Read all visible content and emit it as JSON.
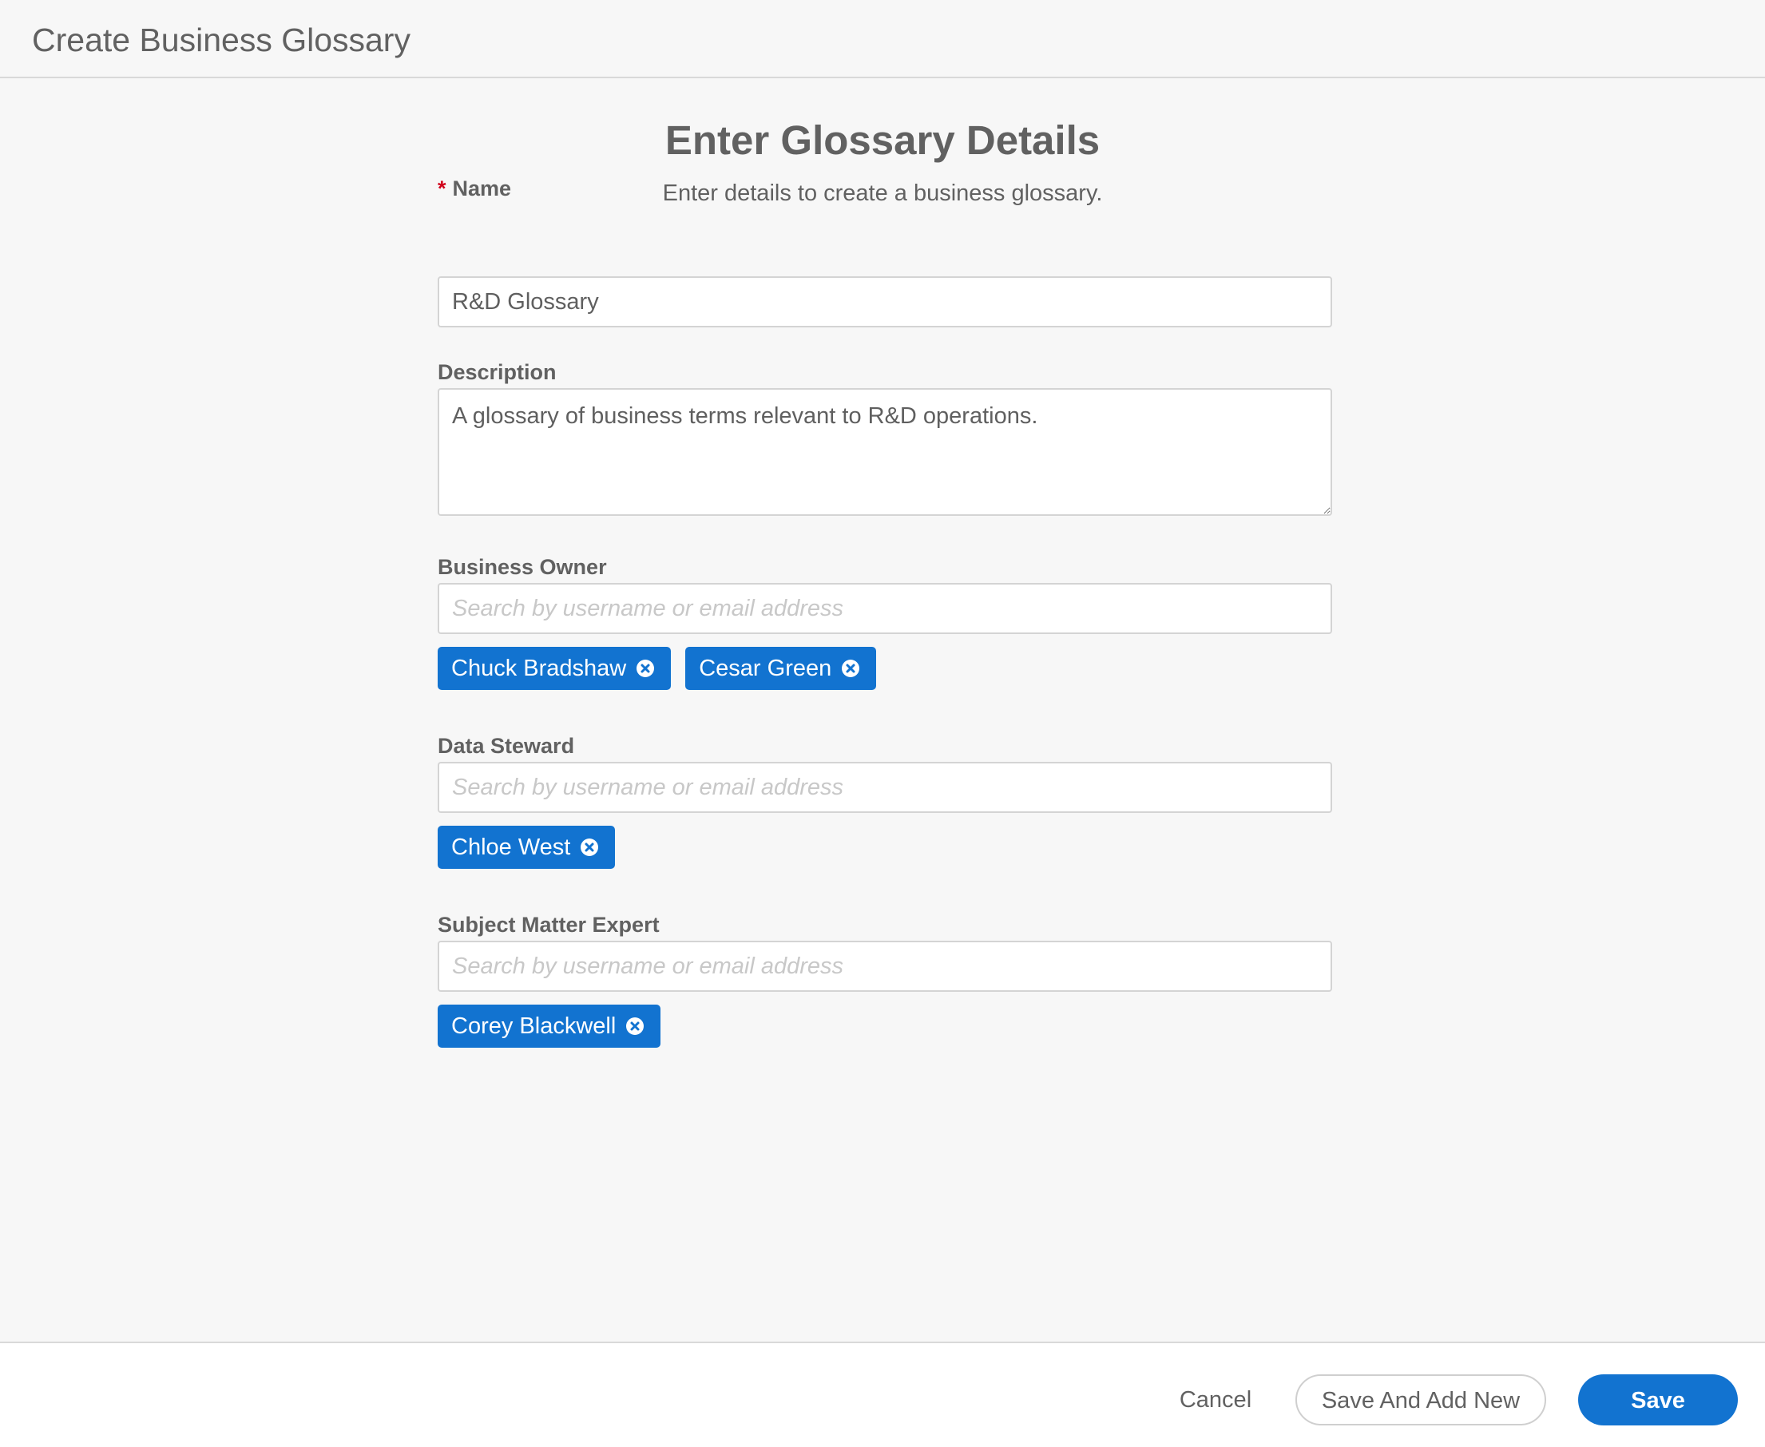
{
  "header": {
    "title": "Create Business Glossary"
  },
  "form": {
    "title": "Enter Glossary Details",
    "subtitle": "Enter details to create a business glossary.",
    "name": {
      "required_marker": "*",
      "label": "Name",
      "value": "R&D Glossary"
    },
    "description": {
      "label": "Description",
      "value": "A glossary of business terms relevant to R&D operations."
    },
    "business_owner": {
      "label": "Business Owner",
      "placeholder": "Search by username or email address",
      "chips": [
        "Chuck Bradshaw",
        "Cesar Green"
      ]
    },
    "data_steward": {
      "label": "Data Steward",
      "placeholder": "Search by username or email address",
      "chips": [
        "Chloe West"
      ]
    },
    "subject_matter_expert": {
      "label": "Subject Matter Expert",
      "placeholder": "Search by username or email address",
      "chips": [
        "Corey Blackwell"
      ]
    }
  },
  "footer": {
    "cancel_label": "Cancel",
    "save_and_add_new_label": "Save And Add New",
    "save_label": "Save"
  },
  "colors": {
    "accent": "#1273d0",
    "required": "#d0021b",
    "background": "#f7f7f7"
  },
  "icons": {
    "chip_remove": "close-circle-icon",
    "textarea_resize": "resize-handle-icon"
  }
}
